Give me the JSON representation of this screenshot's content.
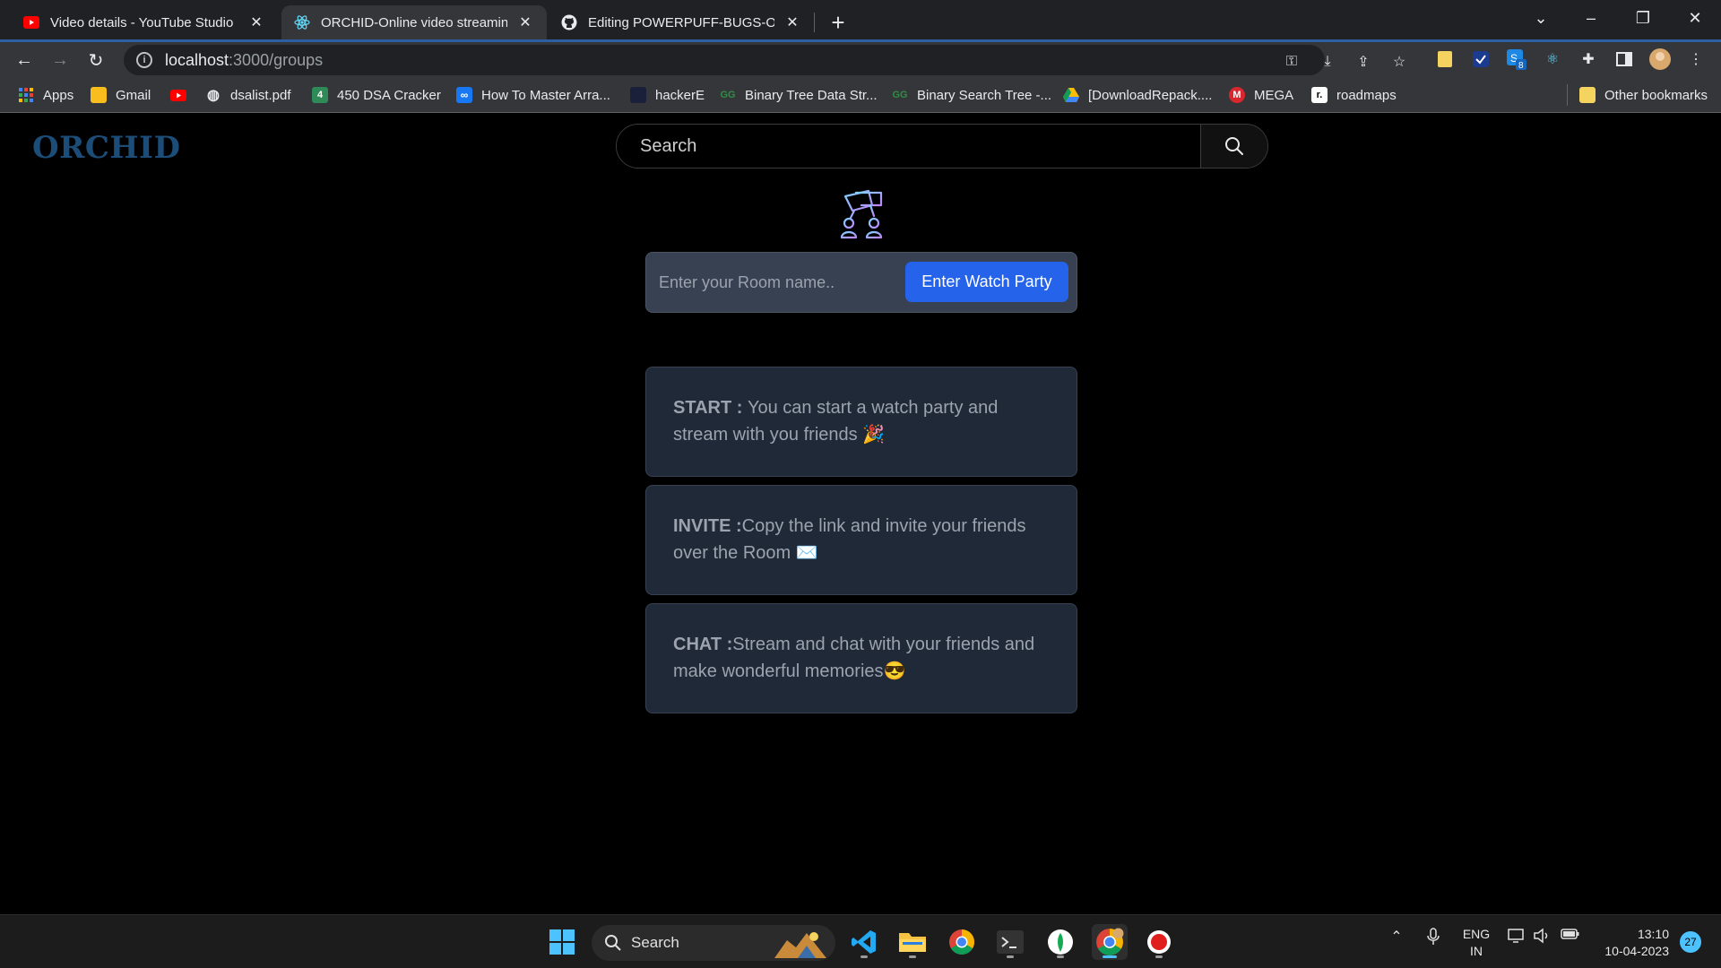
{
  "browser": {
    "tabs": [
      {
        "title": "Video details - YouTube Studio",
        "icon": "youtube-icon"
      },
      {
        "title": "ORCHID-Online video streaming",
        "icon": "react-icon"
      },
      {
        "title": "Editing POWERPUFF-BUGS-ORCHID",
        "icon": "github-icon"
      }
    ],
    "url_host": "localhost",
    "url_path": ":3000/groups",
    "bookmarks": [
      {
        "label": "Apps",
        "icon": "apps-grid-icon"
      },
      {
        "label": "Gmail",
        "icon": "gmail-icon"
      },
      {
        "label": "",
        "icon": "youtube-icon"
      },
      {
        "label": "dsalist.pdf",
        "icon": "globe-icon"
      },
      {
        "label": "450 DSA Cracker",
        "icon": "dsa-cracker-icon"
      },
      {
        "label": "How To Master Arra...",
        "icon": "infinity-icon"
      },
      {
        "label": "hackerE",
        "icon": "hackere-icon"
      },
      {
        "label": "Binary Tree Data Str...",
        "icon": "gfg-icon"
      },
      {
        "label": "Binary Search Tree -...",
        "icon": "gfg-icon"
      },
      {
        "label": "[DownloadRepack....",
        "icon": "drive-icon"
      },
      {
        "label": "MEGA",
        "icon": "mega-icon"
      },
      {
        "label": "roadmaps",
        "icon": "roadmaps-icon"
      }
    ],
    "other_bookmarks": "Other bookmarks",
    "extension_badge": "8"
  },
  "app": {
    "brand": "ORCHID",
    "search_placeholder": "Search",
    "room_placeholder": "Enter your Room name..",
    "enter_button": "Enter Watch Party",
    "cards": [
      {
        "label": "START : ",
        "text": "You can start a watch party and stream with you friends 🎉"
      },
      {
        "label": "INVITE :",
        "text": "Copy the link and invite your friends over the Room ✉️"
      },
      {
        "label": "CHAT :",
        "text": "Stream and chat with your friends and make wonderful memories😎"
      }
    ],
    "colors": {
      "brand": "#1c4d78",
      "button": "#2563eb",
      "card_bg": "#1f2937"
    }
  },
  "taskbar": {
    "search_label": "Search",
    "lang_top": "ENG",
    "lang_bottom": "IN",
    "time": "13:10",
    "date": "10-04-2023",
    "notification_count": "27"
  }
}
